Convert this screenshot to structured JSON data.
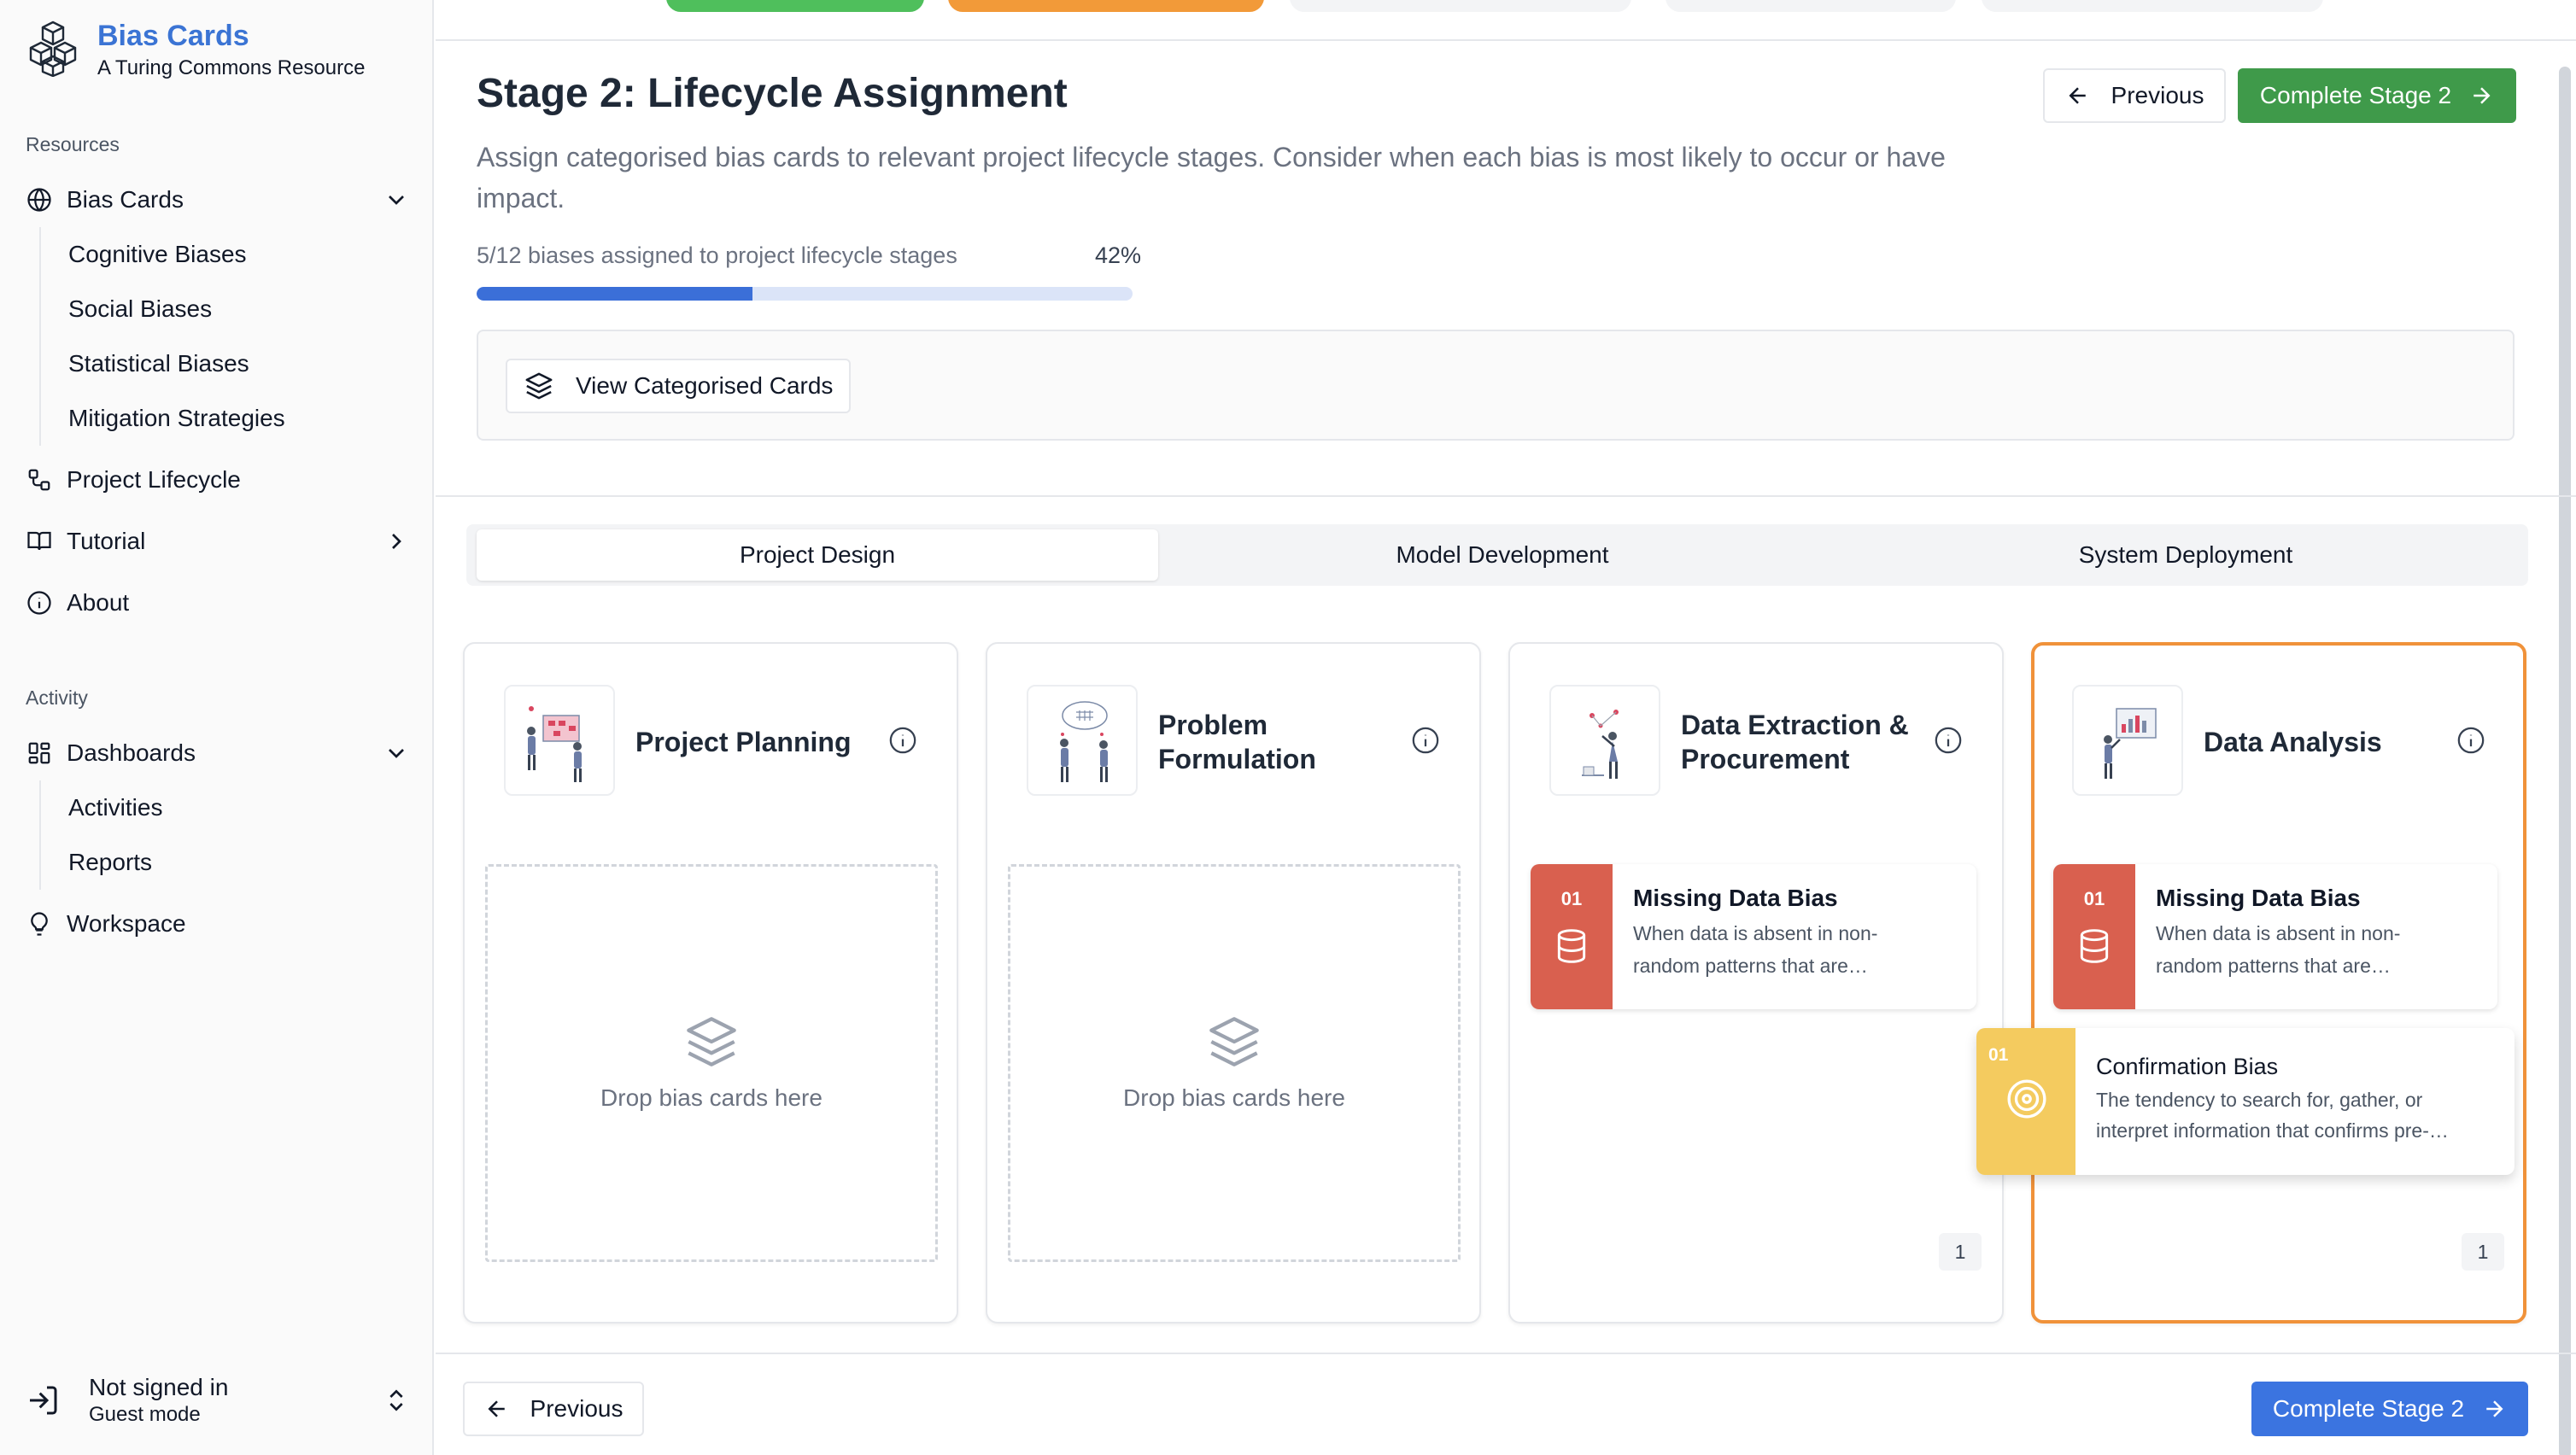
{
  "brand": {
    "title": "Bias Cards",
    "subtitle": "A Turing Commons Resource"
  },
  "sidebar": {
    "resources_label": "Resources",
    "activity_label": "Activity",
    "bias_cards": {
      "label": "Bias Cards",
      "children": [
        "Cognitive Biases",
        "Social Biases",
        "Statistical Biases",
        "Mitigation Strategies"
      ]
    },
    "project_lifecycle": "Project Lifecycle",
    "tutorial": "Tutorial",
    "about": "About",
    "dashboards": {
      "label": "Dashboards",
      "children": [
        "Activities",
        "Reports"
      ]
    },
    "workspace": "Workspace"
  },
  "user": {
    "name": "Not signed in",
    "mode": "Guest mode"
  },
  "stage": {
    "title": "Stage 2: Lifecycle Assignment",
    "description": "Assign categorised bias cards to relevant project lifecycle stages. Consider when each bias is most likely to occur or have impact.",
    "progress_text": "5/12 biases assigned to project lifecycle stages",
    "progress_percent_label": "42%",
    "progress_fraction": 0.42,
    "view_button": "View Categorised Cards"
  },
  "buttons": {
    "previous": "Previous",
    "complete_stage": "Complete Stage 2"
  },
  "tabs": [
    "Project Design",
    "Model Development",
    "System Deployment"
  ],
  "active_tab": "Project Design",
  "lifecycle_stages": [
    {
      "title": "Project Planning",
      "dropzone_text": "Drop bias cards here"
    },
    {
      "title": "Problem Formulation",
      "dropzone_text": "Drop bias cards here"
    },
    {
      "title": "Data Extraction & Procurement",
      "count": "1",
      "cards": [
        {
          "number": "01",
          "name": "Missing Data Bias",
          "description": "When data is absent in non-random patterns that are…",
          "icon": "database-icon"
        }
      ]
    },
    {
      "title": "Data Analysis",
      "count": "1",
      "highlighted": true,
      "cards": [
        {
          "number": "01",
          "name": "Missing Data Bias",
          "description": "When data is absent in non-random patterns that are…",
          "icon": "database-icon"
        }
      ],
      "dragging_card": {
        "number": "01",
        "name": "Confirmation Bias",
        "description": "The tendency to search for, gather, or interpret information that confirms pre-…",
        "icon": "target-icon"
      }
    }
  ],
  "colors": {
    "brand_blue": "#3b74d4",
    "complete_green": "#3f9a4a",
    "complete_blue": "#3b74e0",
    "highlight_orange": "#f0923a",
    "statistical_red": "#d9604f",
    "cognitive_yellow": "#f4cb5f"
  }
}
